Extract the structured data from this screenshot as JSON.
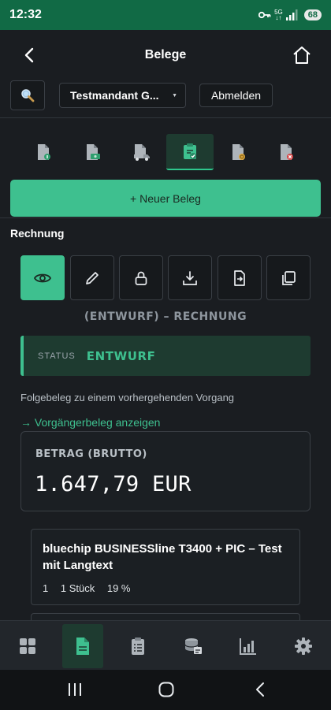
{
  "status_bar": {
    "time": "12:32",
    "network": "5G",
    "battery": "68"
  },
  "header": {
    "title": "Belege"
  },
  "toolbar": {
    "mandant": "Testmandant G...",
    "logout_label": "Abmelden"
  },
  "new_button_label": "+ Neuer Beleg",
  "section_title": "Rechnung",
  "document_heading": "(ENTWURF) – RECHNUNG",
  "status": {
    "label": "STATUS",
    "value": "ENTWURF"
  },
  "follow_text": "Folgebeleg zu einem vorhergehenden Vorgang",
  "previous_link": "→ Vorgängerbeleg anzeigen",
  "amount": {
    "label": "BETRAG (BRUTTO)",
    "value": "1.647,79 EUR"
  },
  "line_item": {
    "title": "bluechip BUSINESSline T3400 + PIC – Test mit Langtext",
    "position": "1",
    "quantity": "1 Stück",
    "tax": "19 %"
  },
  "colors": {
    "accent": "#3ec08f",
    "status_bar": "#116a45",
    "background": "#1a1d21"
  }
}
